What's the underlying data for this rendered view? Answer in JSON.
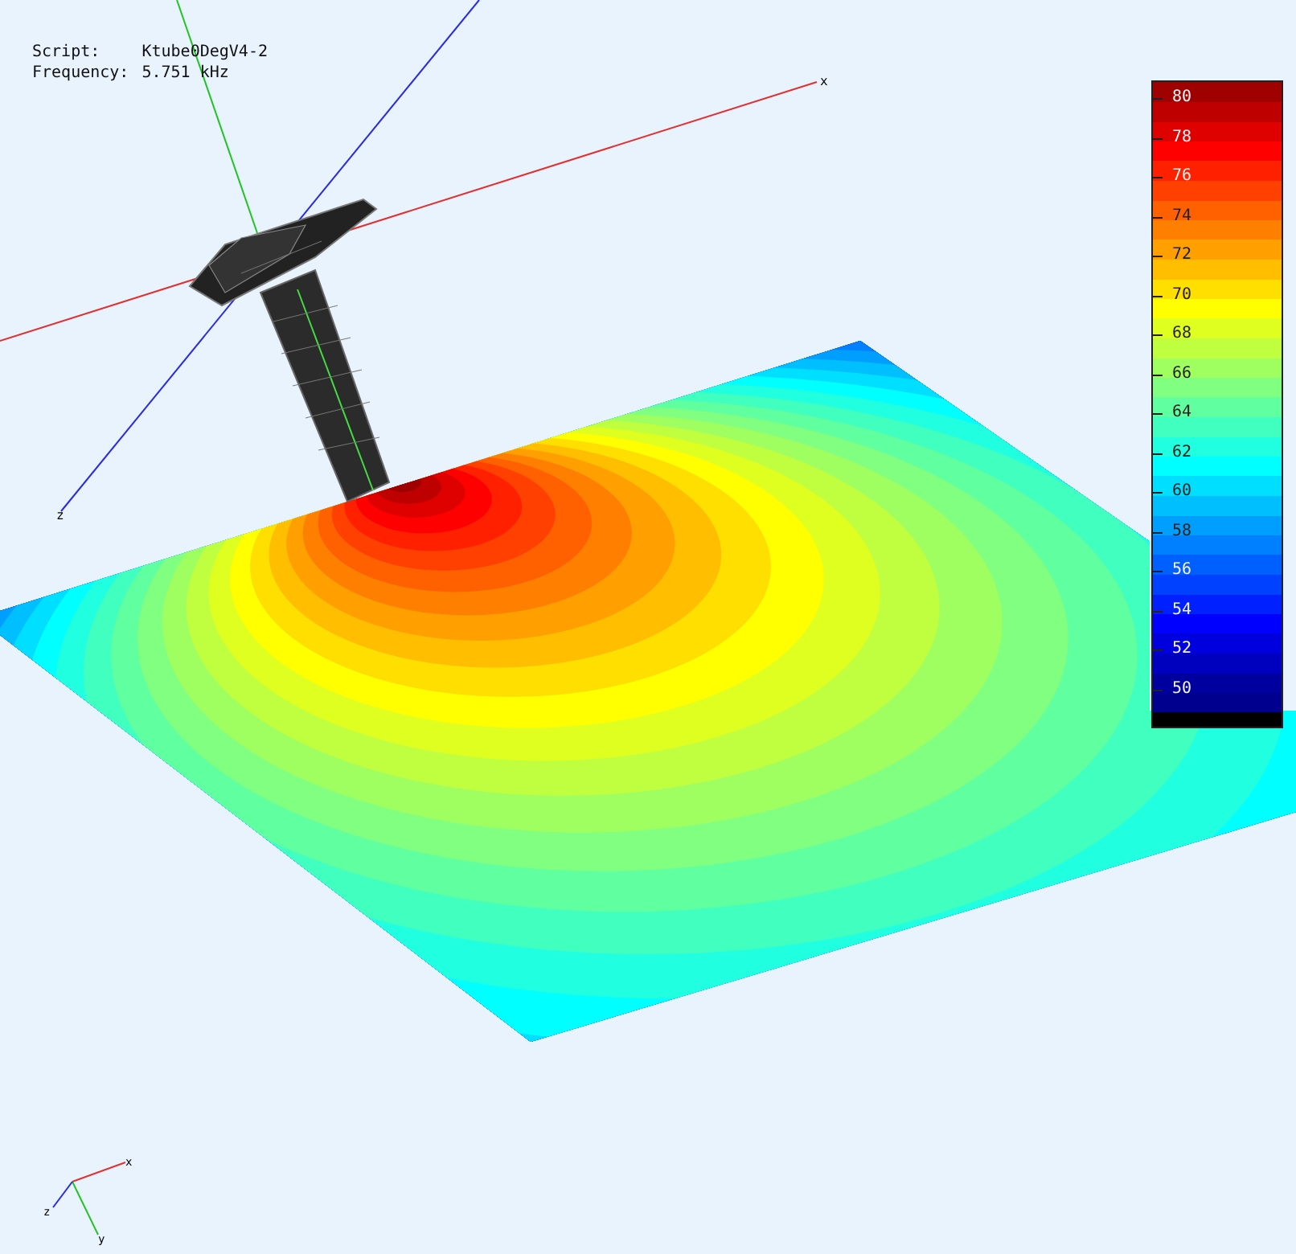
{
  "info": [
    {
      "label": "Script:",
      "value": "Ktube0DegV4-2"
    },
    {
      "label": "Frequency:",
      "value": "5.751 kHz"
    }
  ],
  "axes": {
    "x": "x",
    "z": "z"
  },
  "triad": {
    "x": "x",
    "y": "y",
    "z": "z"
  },
  "legend": {
    "labels": [
      "80",
      "78",
      "76",
      "74",
      "72",
      "70",
      "68",
      "66",
      "64",
      "62",
      "60",
      "58",
      "56",
      "54",
      "52",
      "50"
    ]
  }
}
